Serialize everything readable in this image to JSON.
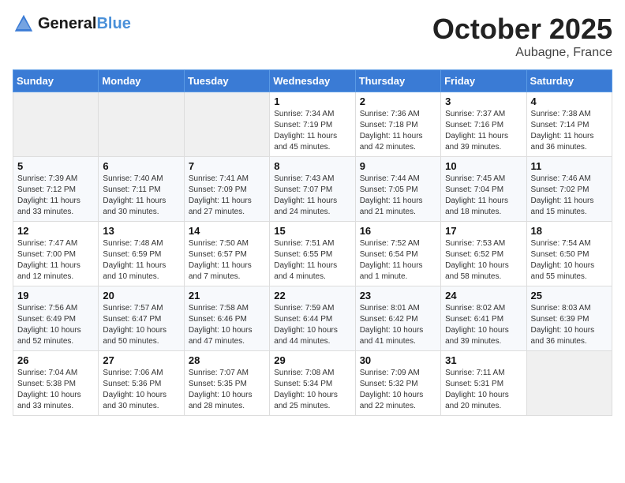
{
  "header": {
    "logo_line1": "General",
    "logo_line2": "Blue",
    "month": "October 2025",
    "location": "Aubagne, France"
  },
  "weekdays": [
    "Sunday",
    "Monday",
    "Tuesday",
    "Wednesday",
    "Thursday",
    "Friday",
    "Saturday"
  ],
  "weeks": [
    [
      {
        "day": "",
        "sunrise": "",
        "sunset": "",
        "daylight": ""
      },
      {
        "day": "",
        "sunrise": "",
        "sunset": "",
        "daylight": ""
      },
      {
        "day": "",
        "sunrise": "",
        "sunset": "",
        "daylight": ""
      },
      {
        "day": "1",
        "sunrise": "Sunrise: 7:34 AM",
        "sunset": "Sunset: 7:19 PM",
        "daylight": "Daylight: 11 hours and 45 minutes."
      },
      {
        "day": "2",
        "sunrise": "Sunrise: 7:36 AM",
        "sunset": "Sunset: 7:18 PM",
        "daylight": "Daylight: 11 hours and 42 minutes."
      },
      {
        "day": "3",
        "sunrise": "Sunrise: 7:37 AM",
        "sunset": "Sunset: 7:16 PM",
        "daylight": "Daylight: 11 hours and 39 minutes."
      },
      {
        "day": "4",
        "sunrise": "Sunrise: 7:38 AM",
        "sunset": "Sunset: 7:14 PM",
        "daylight": "Daylight: 11 hours and 36 minutes."
      }
    ],
    [
      {
        "day": "5",
        "sunrise": "Sunrise: 7:39 AM",
        "sunset": "Sunset: 7:12 PM",
        "daylight": "Daylight: 11 hours and 33 minutes."
      },
      {
        "day": "6",
        "sunrise": "Sunrise: 7:40 AM",
        "sunset": "Sunset: 7:11 PM",
        "daylight": "Daylight: 11 hours and 30 minutes."
      },
      {
        "day": "7",
        "sunrise": "Sunrise: 7:41 AM",
        "sunset": "Sunset: 7:09 PM",
        "daylight": "Daylight: 11 hours and 27 minutes."
      },
      {
        "day": "8",
        "sunrise": "Sunrise: 7:43 AM",
        "sunset": "Sunset: 7:07 PM",
        "daylight": "Daylight: 11 hours and 24 minutes."
      },
      {
        "day": "9",
        "sunrise": "Sunrise: 7:44 AM",
        "sunset": "Sunset: 7:05 PM",
        "daylight": "Daylight: 11 hours and 21 minutes."
      },
      {
        "day": "10",
        "sunrise": "Sunrise: 7:45 AM",
        "sunset": "Sunset: 7:04 PM",
        "daylight": "Daylight: 11 hours and 18 minutes."
      },
      {
        "day": "11",
        "sunrise": "Sunrise: 7:46 AM",
        "sunset": "Sunset: 7:02 PM",
        "daylight": "Daylight: 11 hours and 15 minutes."
      }
    ],
    [
      {
        "day": "12",
        "sunrise": "Sunrise: 7:47 AM",
        "sunset": "Sunset: 7:00 PM",
        "daylight": "Daylight: 11 hours and 12 minutes."
      },
      {
        "day": "13",
        "sunrise": "Sunrise: 7:48 AM",
        "sunset": "Sunset: 6:59 PM",
        "daylight": "Daylight: 11 hours and 10 minutes."
      },
      {
        "day": "14",
        "sunrise": "Sunrise: 7:50 AM",
        "sunset": "Sunset: 6:57 PM",
        "daylight": "Daylight: 11 hours and 7 minutes."
      },
      {
        "day": "15",
        "sunrise": "Sunrise: 7:51 AM",
        "sunset": "Sunset: 6:55 PM",
        "daylight": "Daylight: 11 hours and 4 minutes."
      },
      {
        "day": "16",
        "sunrise": "Sunrise: 7:52 AM",
        "sunset": "Sunset: 6:54 PM",
        "daylight": "Daylight: 11 hours and 1 minute."
      },
      {
        "day": "17",
        "sunrise": "Sunrise: 7:53 AM",
        "sunset": "Sunset: 6:52 PM",
        "daylight": "Daylight: 10 hours and 58 minutes."
      },
      {
        "day": "18",
        "sunrise": "Sunrise: 7:54 AM",
        "sunset": "Sunset: 6:50 PM",
        "daylight": "Daylight: 10 hours and 55 minutes."
      }
    ],
    [
      {
        "day": "19",
        "sunrise": "Sunrise: 7:56 AM",
        "sunset": "Sunset: 6:49 PM",
        "daylight": "Daylight: 10 hours and 52 minutes."
      },
      {
        "day": "20",
        "sunrise": "Sunrise: 7:57 AM",
        "sunset": "Sunset: 6:47 PM",
        "daylight": "Daylight: 10 hours and 50 minutes."
      },
      {
        "day": "21",
        "sunrise": "Sunrise: 7:58 AM",
        "sunset": "Sunset: 6:46 PM",
        "daylight": "Daylight: 10 hours and 47 minutes."
      },
      {
        "day": "22",
        "sunrise": "Sunrise: 7:59 AM",
        "sunset": "Sunset: 6:44 PM",
        "daylight": "Daylight: 10 hours and 44 minutes."
      },
      {
        "day": "23",
        "sunrise": "Sunrise: 8:01 AM",
        "sunset": "Sunset: 6:42 PM",
        "daylight": "Daylight: 10 hours and 41 minutes."
      },
      {
        "day": "24",
        "sunrise": "Sunrise: 8:02 AM",
        "sunset": "Sunset: 6:41 PM",
        "daylight": "Daylight: 10 hours and 39 minutes."
      },
      {
        "day": "25",
        "sunrise": "Sunrise: 8:03 AM",
        "sunset": "Sunset: 6:39 PM",
        "daylight": "Daylight: 10 hours and 36 minutes."
      }
    ],
    [
      {
        "day": "26",
        "sunrise": "Sunrise: 7:04 AM",
        "sunset": "Sunset: 5:38 PM",
        "daylight": "Daylight: 10 hours and 33 minutes."
      },
      {
        "day": "27",
        "sunrise": "Sunrise: 7:06 AM",
        "sunset": "Sunset: 5:36 PM",
        "daylight": "Daylight: 10 hours and 30 minutes."
      },
      {
        "day": "28",
        "sunrise": "Sunrise: 7:07 AM",
        "sunset": "Sunset: 5:35 PM",
        "daylight": "Daylight: 10 hours and 28 minutes."
      },
      {
        "day": "29",
        "sunrise": "Sunrise: 7:08 AM",
        "sunset": "Sunset: 5:34 PM",
        "daylight": "Daylight: 10 hours and 25 minutes."
      },
      {
        "day": "30",
        "sunrise": "Sunrise: 7:09 AM",
        "sunset": "Sunset: 5:32 PM",
        "daylight": "Daylight: 10 hours and 22 minutes."
      },
      {
        "day": "31",
        "sunrise": "Sunrise: 7:11 AM",
        "sunset": "Sunset: 5:31 PM",
        "daylight": "Daylight: 10 hours and 20 minutes."
      },
      {
        "day": "",
        "sunrise": "",
        "sunset": "",
        "daylight": ""
      }
    ]
  ]
}
